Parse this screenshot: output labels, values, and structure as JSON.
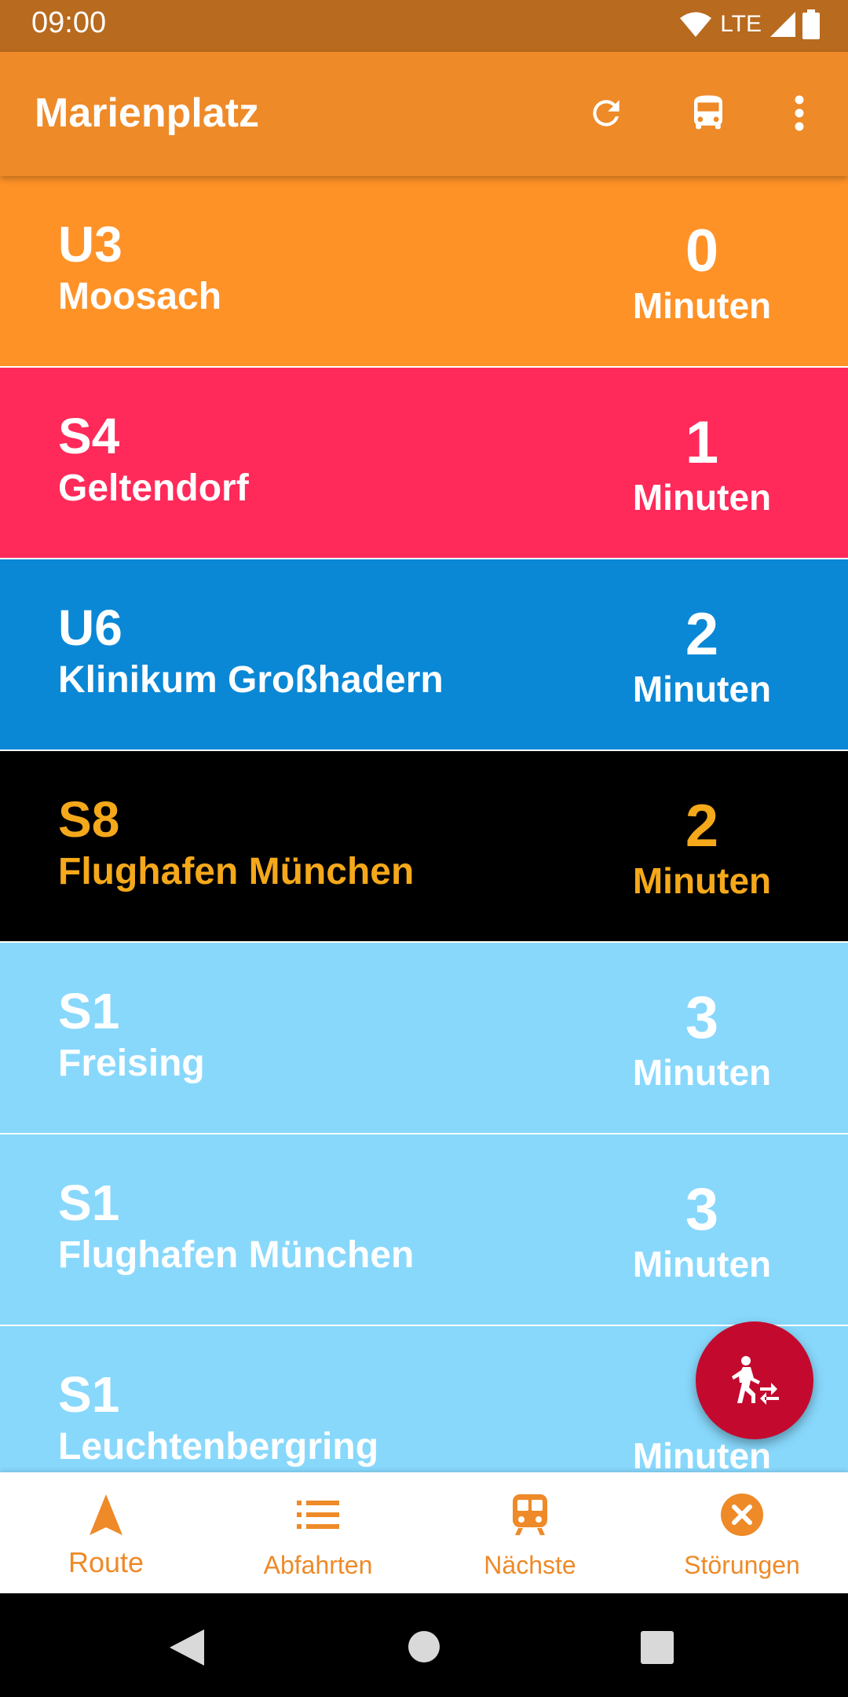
{
  "status_bar": {
    "time": "09:00",
    "network": "LTE",
    "icons": [
      "wifi-icon",
      "cell-signal-icon",
      "battery-icon"
    ]
  },
  "app_bar": {
    "title": "Marienplatz",
    "actions": [
      "refresh-icon",
      "bus-icon",
      "more-vert-icon"
    ]
  },
  "departures": [
    {
      "line": "U3",
      "destination": "Moosach",
      "minutes": "0",
      "unit": "Minuten",
      "bg": "#FF9227",
      "fg": "#FFFFFF"
    },
    {
      "line": "S4",
      "destination": "Geltendorf",
      "minutes": "1",
      "unit": "Minuten",
      "bg": "#FF2A5A",
      "fg": "#FFFFFF"
    },
    {
      "line": "U6",
      "destination": "Klinikum Großhadern",
      "minutes": "2",
      "unit": "Minuten",
      "bg": "#0A88D6",
      "fg": "#FFFFFF"
    },
    {
      "line": "S8",
      "destination": "Flughafen München",
      "minutes": "2",
      "unit": "Minuten",
      "bg": "#000000",
      "fg": "#F4A81A"
    },
    {
      "line": "S1",
      "destination": "Freising",
      "minutes": "3",
      "unit": "Minuten",
      "bg": "#88D8FC",
      "fg": "#FFFFFF"
    },
    {
      "line": "S1",
      "destination": "Flughafen München",
      "minutes": "3",
      "unit": "Minuten",
      "bg": "#88D8FC",
      "fg": "#FFFFFF"
    },
    {
      "line": "S1",
      "destination": "Leuchtenbergring",
      "minutes": "",
      "unit": "Minuten",
      "bg": "#88D8FC",
      "fg": "#FFFFFF"
    }
  ],
  "fab": {
    "icon": "transfer-walk-icon",
    "color": "#C4092E"
  },
  "bottom_nav": {
    "items": [
      {
        "label": "Route",
        "icon": "navigation-arrow-icon",
        "active": true
      },
      {
        "label": "Abfahrten",
        "icon": "list-icon",
        "active": false
      },
      {
        "label": "Nächste",
        "icon": "train-icon",
        "active": false
      },
      {
        "label": "Störungen",
        "icon": "cancel-circle-icon",
        "active": false
      }
    ],
    "accent": "#EE8A28"
  },
  "system_nav": [
    "back-icon",
    "home-icon",
    "recents-icon"
  ]
}
